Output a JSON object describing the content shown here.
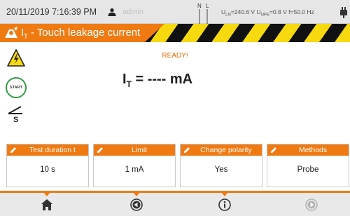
{
  "status": {
    "datetime": "20/11/2019 7:16:39 PM",
    "user": "admin",
    "ne_labels": [
      "N",
      "L"
    ],
    "measurements": [
      {
        "sym": "U",
        "sub": "LN",
        "val": "=240.6 V"
      },
      {
        "sym": "U",
        "sub": "NPE",
        "val": "=0.8 V"
      },
      {
        "sym": "f",
        "sub": "",
        "val": "=50.0 Hz"
      }
    ],
    "icons": [
      "user-icon",
      "plug-icon"
    ]
  },
  "title": {
    "prefix": "I",
    "prefix_sub": "T",
    "text": " - Touch leakage current",
    "icon": "tester-icon"
  },
  "main": {
    "status_text": "READY!",
    "reading": {
      "symbol": "I",
      "sub": "T",
      "value": " = ---- mA"
    },
    "start_label": "START",
    "sensitivity_label": "S"
  },
  "params": [
    {
      "label": "Test duration t",
      "value": "10 s"
    },
    {
      "label": "Limit",
      "value": "1 mA"
    },
    {
      "label": "Change polarity",
      "value": "Yes"
    },
    {
      "label": "Methods",
      "value": "Probe"
    }
  ],
  "nav": [
    "home-icon",
    "back-icon",
    "info-icon",
    "forward-icon"
  ],
  "colors": {
    "accent": "#f07a12",
    "stripe_yellow": "#f6d90e",
    "start_ring": "#2f9e44"
  }
}
